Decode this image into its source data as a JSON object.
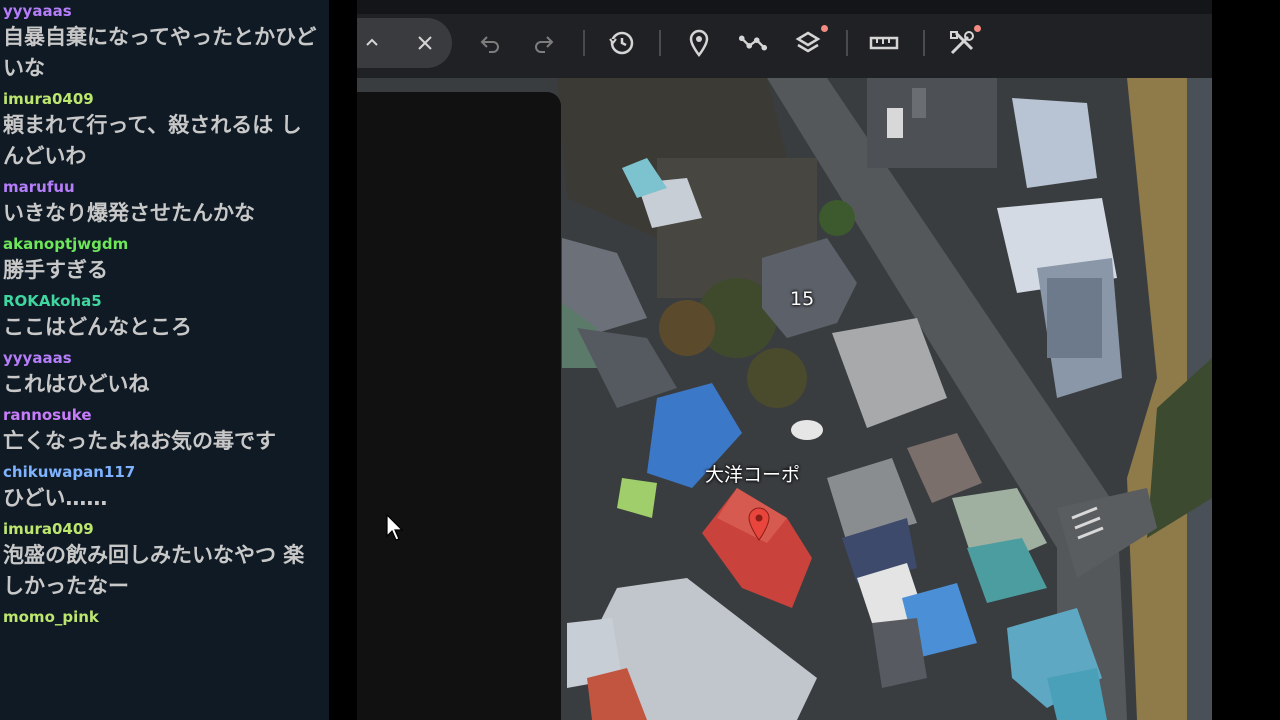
{
  "chat": {
    "messages": [
      {
        "user": "yyyaaas",
        "color": "#b57dfa",
        "text": "自暴自棄になってやったとかひどいな"
      },
      {
        "user": "imura0409",
        "color": "#bde66e",
        "text": "頼まれて行って、殺されるは しんどいわ"
      },
      {
        "user": "marufuu",
        "color": "#b57dfa",
        "text": "いきなり爆発させたんかな"
      },
      {
        "user": "akanoptjwgdm",
        "color": "#6ee65a",
        "text": "勝手すぎる"
      },
      {
        "user": "ROKAkoha5",
        "color": "#3fd6a0",
        "text": "ここはどんなところ"
      },
      {
        "user": "yyyaaas",
        "color": "#b57dfa",
        "text": "これはひどいね"
      },
      {
        "user": "rannosuke",
        "color": "#c77dfa",
        "text": "亡くなったよねお気の毒です"
      },
      {
        "user": "chikuwapan117",
        "color": "#7fb3ff",
        "text": "ひどい……"
      },
      {
        "user": "imura0409",
        "color": "#bde66e",
        "text": "泡盛の飲み回しみたいなやつ 楽しかったなー"
      },
      {
        "user": "momo_pink",
        "color": "#bde66e",
        "text": ""
      }
    ]
  },
  "toolbar": {
    "collapse_icon": "chevron-up-icon",
    "close_icon": "close-icon",
    "undo_icon": "undo-icon",
    "redo_icon": "redo-icon",
    "history_icon": "history-icon",
    "placemark_icon": "placemark-icon",
    "path_icon": "path-icon",
    "layers_icon": "layers-icon",
    "measure_icon": "ruler-icon",
    "tools_icon": "tools-icon",
    "notification_color": "#f28b82"
  },
  "map": {
    "building_number": "15",
    "place_label": "大洋コーポ",
    "pin_color": "#e8453c",
    "marked_roof_color": "#c9423c"
  }
}
